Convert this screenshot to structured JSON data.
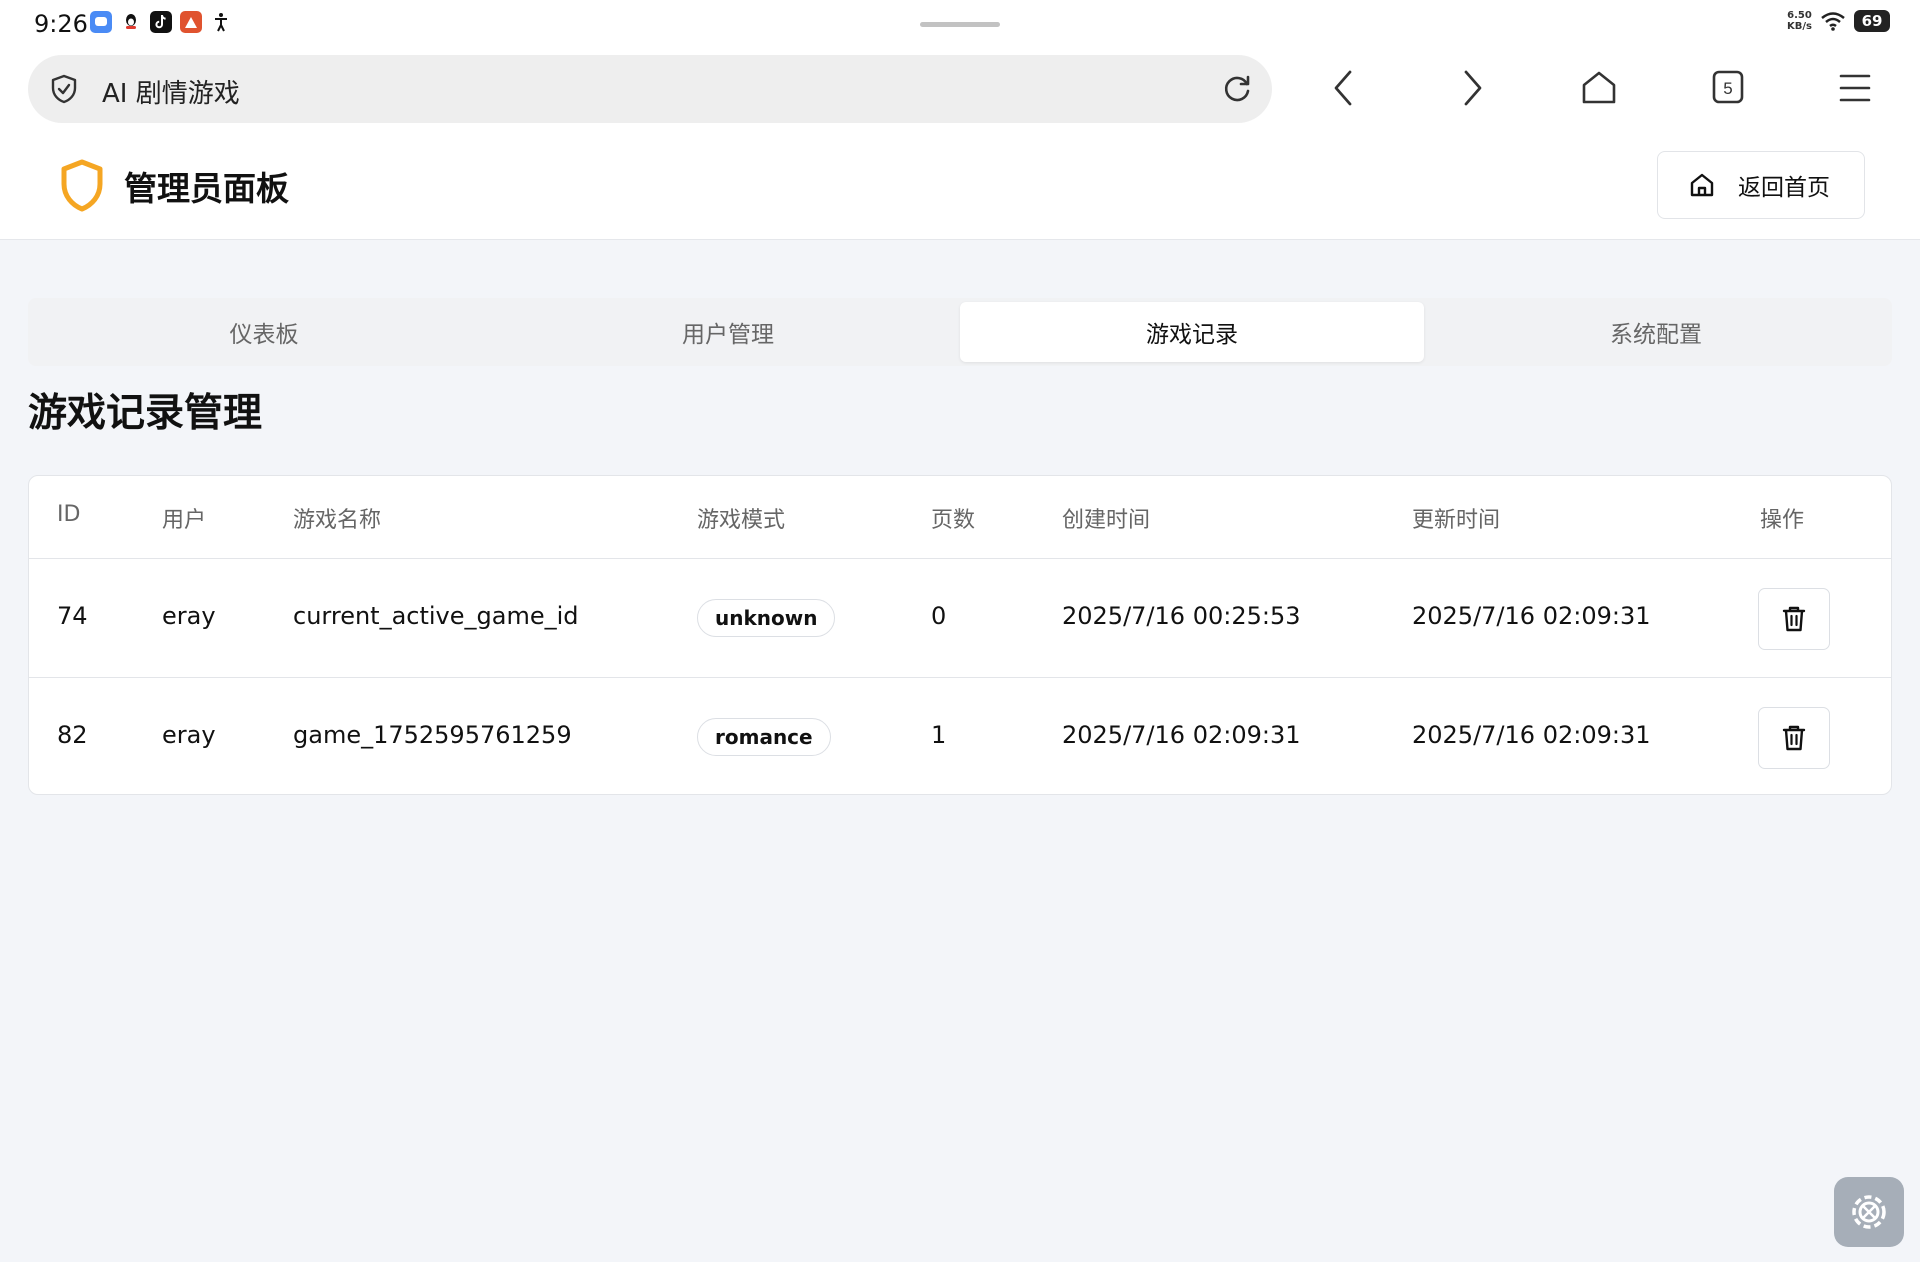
{
  "status_bar": {
    "time": "9:26",
    "net_speed_value": "6.50",
    "net_speed_unit": "KB/s",
    "battery": "69",
    "app_icons": [
      "chat-bubble-icon",
      "qq-penguin-icon",
      "tiktok-icon",
      "red-app-icon",
      "accessibility-icon"
    ]
  },
  "browser": {
    "url_title": "AI 剧情游戏",
    "tab_count": "5"
  },
  "header": {
    "title": "管理员面板",
    "home_button": "返回首页",
    "brand_color": "#f5a623"
  },
  "tabs": [
    {
      "label": "仪表板",
      "active": false
    },
    {
      "label": "用户管理",
      "active": false
    },
    {
      "label": "游戏记录",
      "active": true
    },
    {
      "label": "系统配置",
      "active": false
    }
  ],
  "section_title": "游戏记录管理",
  "table": {
    "columns": [
      "ID",
      "用户",
      "游戏名称",
      "游戏模式",
      "页数",
      "创建时间",
      "更新时间",
      "操作"
    ],
    "rows": [
      {
        "id": "74",
        "user": "eray",
        "name": "current_active_game_id",
        "mode": "unknown",
        "pages": "0",
        "created": "2025/7/16 00:25:53",
        "updated": "2025/7/16 02:09:31"
      },
      {
        "id": "82",
        "user": "eray",
        "name": "game_1752595761259",
        "mode": "romance",
        "pages": "1",
        "created": "2025/7/16 02:09:31",
        "updated": "2025/7/16 02:09:31"
      }
    ]
  }
}
